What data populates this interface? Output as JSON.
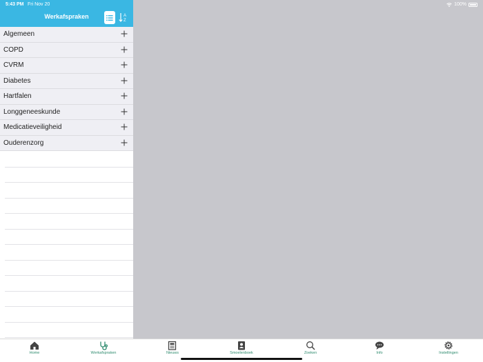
{
  "status_bar": {
    "time": "5:43 PM",
    "date": "Fri Nov 20",
    "battery": "100%"
  },
  "nav": {
    "title": "Werkafspraken"
  },
  "categories": [
    {
      "label": "Algemeen"
    },
    {
      "label": "COPD"
    },
    {
      "label": "CVRM"
    },
    {
      "label": "Diabetes"
    },
    {
      "label": "Hartfalen"
    },
    {
      "label": "Longgeneeskunde"
    },
    {
      "label": "Medicatieveiligheid"
    },
    {
      "label": "Ouderenzorg"
    }
  ],
  "tabs": [
    {
      "label": "Home",
      "icon": "home-icon"
    },
    {
      "label": "Werkafspraken",
      "icon": "stethoscope-icon",
      "active": true
    },
    {
      "label": "Nieuws",
      "icon": "newspaper-icon"
    },
    {
      "label": "Smoelenboek",
      "icon": "contact-book-icon"
    },
    {
      "label": "Zoeken",
      "icon": "search-icon"
    },
    {
      "label": "Info",
      "icon": "chat-bubble-icon"
    },
    {
      "label": "Instellingen",
      "icon": "gear-icon"
    }
  ],
  "colors": {
    "nav_bar": "#3ab7e3",
    "tab_tint": "#2e8b6e",
    "detail_background": "#c7c7cc"
  }
}
